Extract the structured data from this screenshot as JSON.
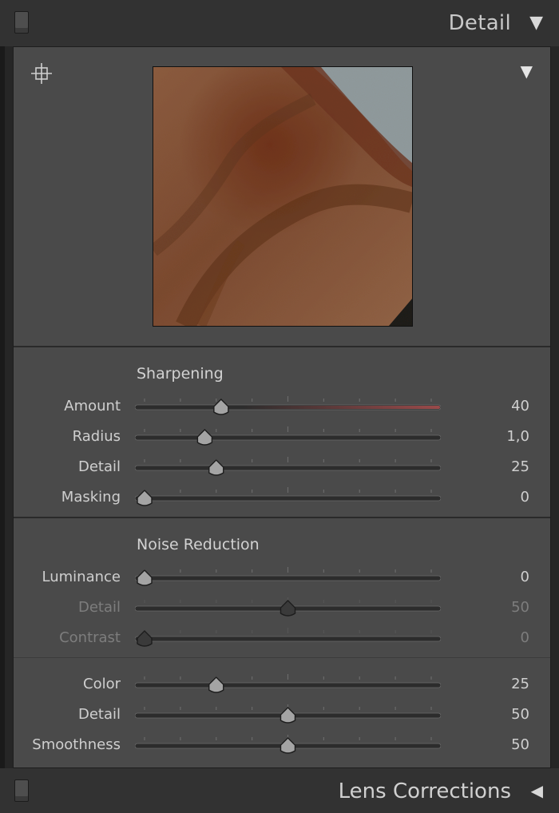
{
  "header": {
    "title": "Detail",
    "collapse_icon": "triangle-down-icon"
  },
  "preview": {
    "target_icon": "crosshair-target-icon",
    "menu_icon": "triangle-down-icon"
  },
  "sharpening": {
    "title": "Sharpening",
    "rows": [
      {
        "key": "amount",
        "label": "Amount",
        "value": "40",
        "fraction": 0.267,
        "accent": "#9a4a4a",
        "dim": false
      },
      {
        "key": "radius",
        "label": "Radius",
        "value": "1,0",
        "fraction": 0.21,
        "accent": "",
        "dim": false
      },
      {
        "key": "detail",
        "label": "Detail",
        "value": "25",
        "fraction": 0.25,
        "accent": "",
        "dim": false
      },
      {
        "key": "masking",
        "label": "Masking",
        "value": "0",
        "fraction": 0.0,
        "accent": "",
        "dim": false
      }
    ]
  },
  "noise_reduction": {
    "title": "Noise Reduction",
    "luminance_rows": [
      {
        "key": "luminance",
        "label": "Luminance",
        "value": "0",
        "fraction": 0.0,
        "dim": false
      },
      {
        "key": "lum-detail",
        "label": "Detail",
        "value": "50",
        "fraction": 0.5,
        "dim": true
      },
      {
        "key": "contrast",
        "label": "Contrast",
        "value": "0",
        "fraction": 0.0,
        "dim": true
      }
    ],
    "color_rows": [
      {
        "key": "color",
        "label": "Color",
        "value": "25",
        "fraction": 0.25,
        "dim": false
      },
      {
        "key": "color-detail",
        "label": "Detail",
        "value": "50",
        "fraction": 0.5,
        "dim": false
      },
      {
        "key": "smoothness",
        "label": "Smoothness",
        "value": "50",
        "fraction": 0.5,
        "dim": false
      }
    ]
  },
  "footer": {
    "title": "Lens Corrections",
    "expand_icon": "triangle-left-icon"
  },
  "colors": {
    "panel_bg": "#4a4a4a",
    "header_bg": "#323232",
    "amount_accent": "#9a4a4a"
  }
}
